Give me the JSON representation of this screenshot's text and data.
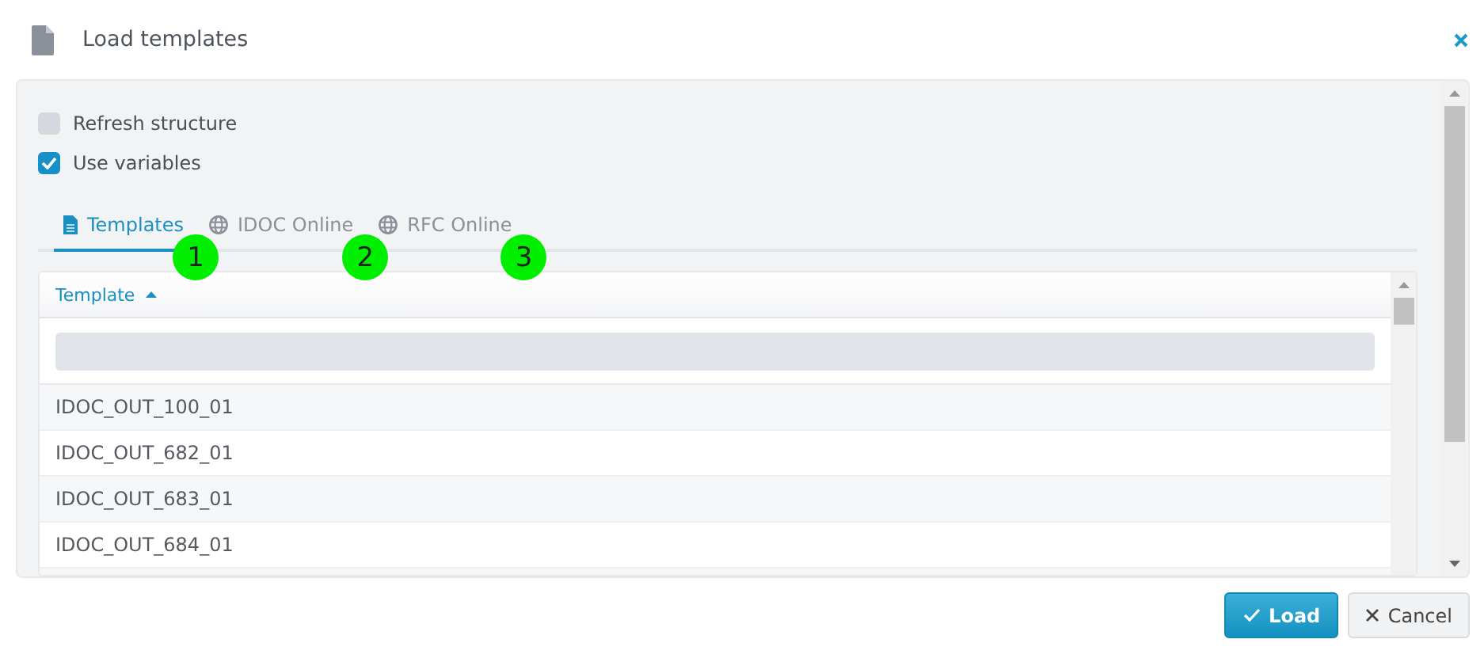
{
  "dialog": {
    "title": "Load templates"
  },
  "options": [
    {
      "label": "Refresh structure",
      "checked": false
    },
    {
      "label": "Use variables",
      "checked": true
    }
  ],
  "tabs": [
    {
      "label": "Templates",
      "selected": true
    },
    {
      "label": "IDOC Online",
      "selected": false
    },
    {
      "label": "RFC Online",
      "selected": false
    }
  ],
  "callouts": [
    "1",
    "2",
    "3"
  ],
  "table": {
    "columns": [
      {
        "label": "Template"
      }
    ],
    "rows": [
      "IDOC_OUT_100_01",
      "IDOC_OUT_682_01",
      "IDOC_OUT_683_01",
      "IDOC_OUT_684_01"
    ]
  },
  "buttons": [
    {
      "label": "Load",
      "kind": "primary"
    },
    {
      "label": "Cancel",
      "kind": "secondary"
    }
  ]
}
